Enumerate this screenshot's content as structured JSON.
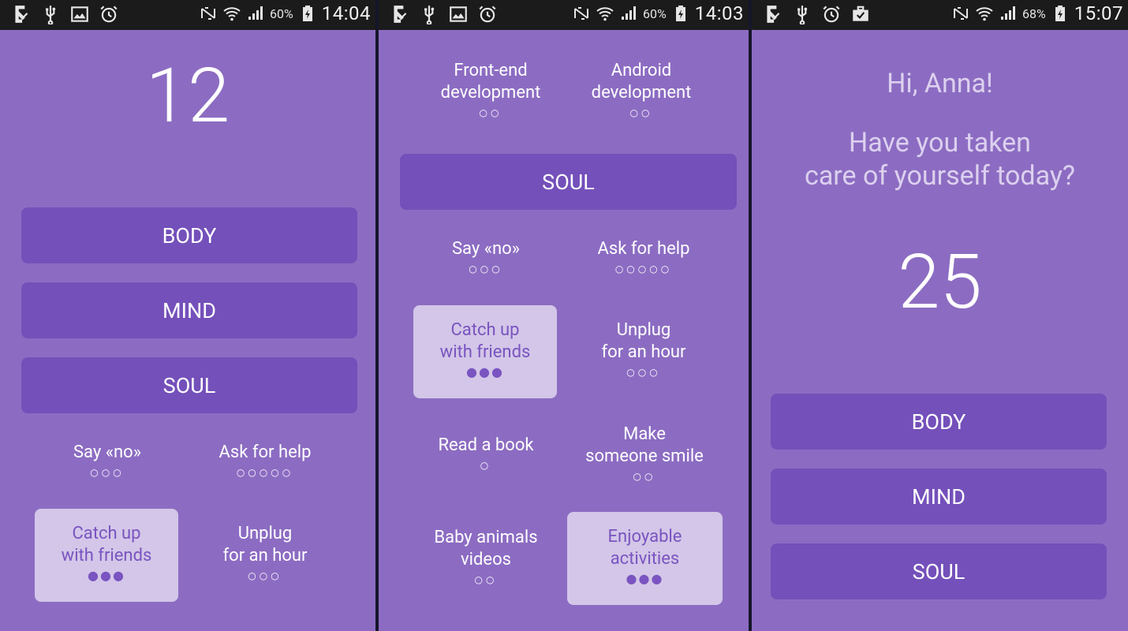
{
  "screens": [
    {
      "status": {
        "battery": "60%",
        "time": "14:04"
      },
      "score": "12",
      "categories": [
        "BODY",
        "MIND",
        "SOUL"
      ],
      "tasks": [
        {
          "label": "Say «no»",
          "dots": "○○○"
        },
        {
          "label": "Ask for help",
          "dots": "○○○○○"
        },
        {
          "label": "Catch up\nwith friends",
          "dots": "●●●",
          "selected": true
        },
        {
          "label": "Unplug\nfor an hour",
          "dots": "○○○"
        }
      ]
    },
    {
      "status": {
        "battery": "60%",
        "time": "14:03"
      },
      "top_tasks": [
        {
          "label": "Front-end\ndevelopment",
          "dots": "○○"
        },
        {
          "label": "Android\ndevelopment",
          "dots": "○○"
        }
      ],
      "category": "SOUL",
      "tasks": [
        {
          "label": "Say «no»",
          "dots": "○○○"
        },
        {
          "label": "Ask for help",
          "dots": "○○○○○"
        },
        {
          "label": "Catch up\nwith friends",
          "dots": "●●●",
          "selected": true
        },
        {
          "label": "Unplug\nfor an hour",
          "dots": "○○○"
        },
        {
          "label": "Read a book",
          "dots": "○"
        },
        {
          "label": "Make\nsomeone smile",
          "dots": "○○"
        },
        {
          "label": "Baby animals\nvideos",
          "dots": "○○"
        },
        {
          "label": "Enjoyable\nactivities",
          "dots": "●●●",
          "selected": true
        }
      ]
    },
    {
      "status": {
        "battery": "68%",
        "time": "15:07"
      },
      "greeting": "Hi, Anna!",
      "question_line1": "Have you taken",
      "question_line2": "care of yourself today?",
      "score": "25",
      "categories": [
        "BODY",
        "MIND",
        "SOUL"
      ]
    }
  ],
  "colors": {
    "background": "#8c6cc2",
    "button": "#7450ba",
    "selected_tile": "#d3c6e8",
    "statusbar": "#1b1b1b"
  },
  "icons": {
    "status_left_1": [
      "download-done-icon",
      "usb-icon",
      "image-icon",
      "alarm-icon"
    ],
    "status_left_3": [
      "download-done-icon",
      "usb-icon",
      "alarm-icon",
      "briefcase-icon"
    ],
    "status_right": [
      "nfc-icon",
      "wifi-icon",
      "signal-icon",
      "battery-charging-icon"
    ]
  }
}
